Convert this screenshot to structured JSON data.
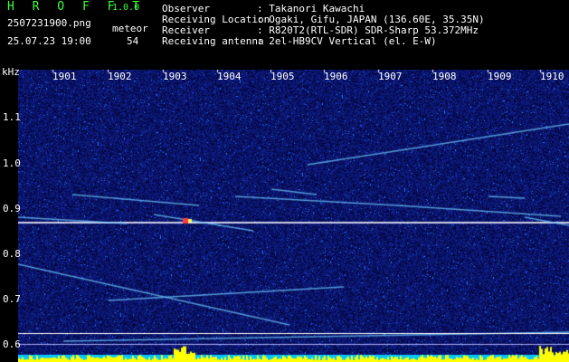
{
  "app": {
    "title": "H R O F F T",
    "version": "1.0.0"
  },
  "file": {
    "name": "2507231900.png",
    "timestamp": "25.07.23 19:00"
  },
  "meteor": {
    "label": "meteor",
    "count": "54"
  },
  "info": [
    {
      "label": "Observer",
      "value": ": Takanori Kawachi"
    },
    {
      "label": "Receiving Location",
      "value": ": Ogaki, Gifu, JAPAN (136.60E, 35.35N)"
    },
    {
      "label": "Receiver",
      "value": ": R820T2(RTL-SDR) SDR-Sharp 53.372MHz"
    },
    {
      "label": "Receiving antenna",
      "value": ": 2el-HB9CV Vertical (el. E-W)"
    }
  ],
  "axis": {
    "y_unit": "kHz",
    "y_ticks": [
      "1.1",
      "1.0",
      "0.9",
      "0.8",
      "0.7",
      "0.6"
    ],
    "x_ticks": [
      "1901",
      "1902",
      "1903",
      "1904",
      "1905",
      "1906",
      "1907",
      "1908",
      "1909",
      "1910"
    ]
  },
  "colors": {
    "background": "#000000",
    "spectrogram_base": "#0a0a6e",
    "carrier": "#ffffff",
    "meteor_trail": "#4fc3ff",
    "level_bars": "#ffff00",
    "level_base": "#00c8ff"
  }
}
